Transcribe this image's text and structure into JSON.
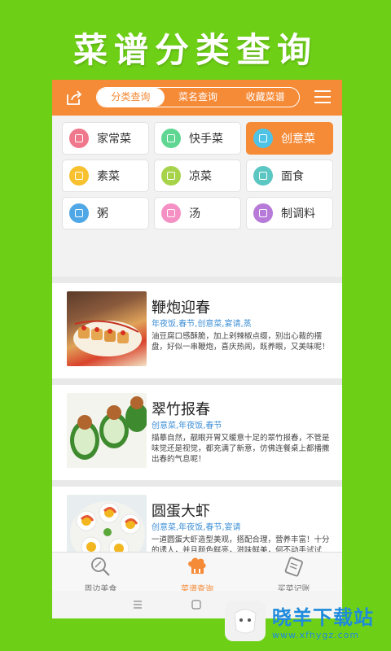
{
  "promo": {
    "title": "菜谱分类查询"
  },
  "header": {
    "tabs": [
      {
        "label": "分类查询",
        "active": true
      },
      {
        "label": "菜名查询",
        "active": false
      },
      {
        "label": "收藏菜谱",
        "active": false
      }
    ],
    "accent_color": "#f58a37"
  },
  "categories": [
    {
      "label": "家常菜",
      "icon": "pot-icon",
      "color": "#f0788c",
      "active": false
    },
    {
      "label": "快手菜",
      "icon": "fast-icon",
      "color": "#5fd692",
      "active": false
    },
    {
      "label": "创意菜",
      "icon": "idea-icon",
      "color": "#4fc3e6",
      "active": true
    },
    {
      "label": "素菜",
      "icon": "veg-icon",
      "color": "#f7c12f",
      "active": false
    },
    {
      "label": "凉菜",
      "icon": "cold-icon",
      "color": "#a7d34a",
      "active": false
    },
    {
      "label": "面食",
      "icon": "noodle-icon",
      "color": "#5cc6c3",
      "active": false
    },
    {
      "label": "粥",
      "icon": "porridge-icon",
      "color": "#4fa7e6",
      "active": false
    },
    {
      "label": "汤",
      "icon": "soup-icon",
      "color": "#f490c3",
      "active": false
    },
    {
      "label": "制调料",
      "icon": "sauce-icon",
      "color": "#b77ad8",
      "active": false
    }
  ],
  "recipes": [
    {
      "title": "鞭炮迎春",
      "tags": "年夜饭,春节,创意菜,宴请,蒸",
      "desc": "油豆腐口感酥脆，加上剁辣椒点缀，别出心裁的摆盘，好似一串鞭炮，喜庆热闹，既养眼，又美味呢！"
    },
    {
      "title": "翠竹报春",
      "tags": "创意菜,年夜饭,春节",
      "desc": "描摹自然，靓眼开胃又暖意十足的翠竹报春，不管是味觉还是视觉，都充满了新意，仿佛连餐桌上都播撒出春的气息呢！"
    },
    {
      "title": "圆蛋大虾",
      "tags": "创意菜,年夜饭,春节,宴请",
      "desc": "一道圆蛋大虾造型美观，搭配合理，营养丰富！十分的诱人，并且颜色鲜亮，滋味鲜美，何不动手试试呢！"
    }
  ],
  "bottom_nav": [
    {
      "label": "周边美食",
      "icon": "magnifier-icon",
      "active": false
    },
    {
      "label": "菜谱查询",
      "icon": "chef-hat-icon",
      "active": true
    },
    {
      "label": "买菜记账",
      "icon": "notebook-icon",
      "active": false
    }
  ],
  "watermark": {
    "brand": "晓羊下载站",
    "url": "www.xfhygz.com"
  }
}
